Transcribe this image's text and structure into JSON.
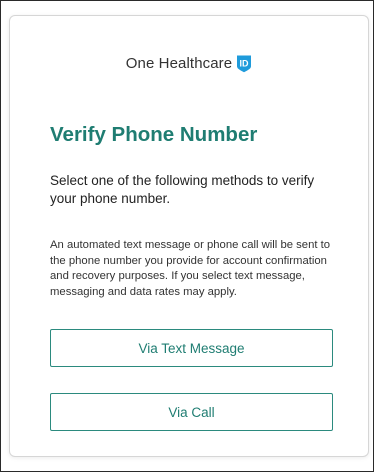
{
  "brand": {
    "name": "One Healthcare",
    "badge_text": "ID",
    "badge_color": "#1f9bdb"
  },
  "page": {
    "title": "Verify Phone Number",
    "intro": "Select one of the following methods to verify your phone number.",
    "notice": "An automated text message or phone call will be sent to the phone number you provide for account confirmation and recovery purposes. If you select text message, messaging and data rates may apply."
  },
  "actions": {
    "text_message_label": "Via Text Message",
    "call_label": "Via Call"
  },
  "colors": {
    "accent": "#1f7d72",
    "button_border": "#2b8a7e"
  }
}
